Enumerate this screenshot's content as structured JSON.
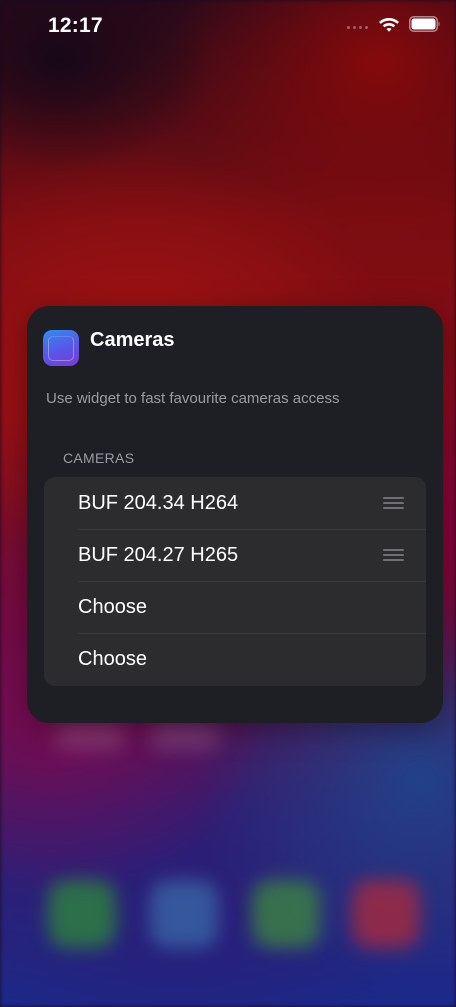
{
  "status_bar": {
    "time": "12:17"
  },
  "widget": {
    "app_title": "Cameras",
    "description": "Use widget to fast favourite cameras access",
    "section_header": "CAMERAS",
    "rows": [
      {
        "label": "BUF 204.34 H264",
        "reorderable": true
      },
      {
        "label": "BUF 204.27 H265",
        "reorderable": true
      },
      {
        "label": "Choose",
        "reorderable": false
      },
      {
        "label": "Choose",
        "reorderable": false
      }
    ]
  },
  "icons": {
    "status": [
      "cellular-signal-icon",
      "wifi-icon",
      "battery-icon"
    ],
    "app": "cameras-app-icon",
    "row_action": "reorder-handle-icon"
  },
  "colors": {
    "card_background": "#1d1f25",
    "list_background": "#2c2c2f",
    "secondary_text": "#9a9ca3",
    "primary_text": "#ffffff"
  }
}
